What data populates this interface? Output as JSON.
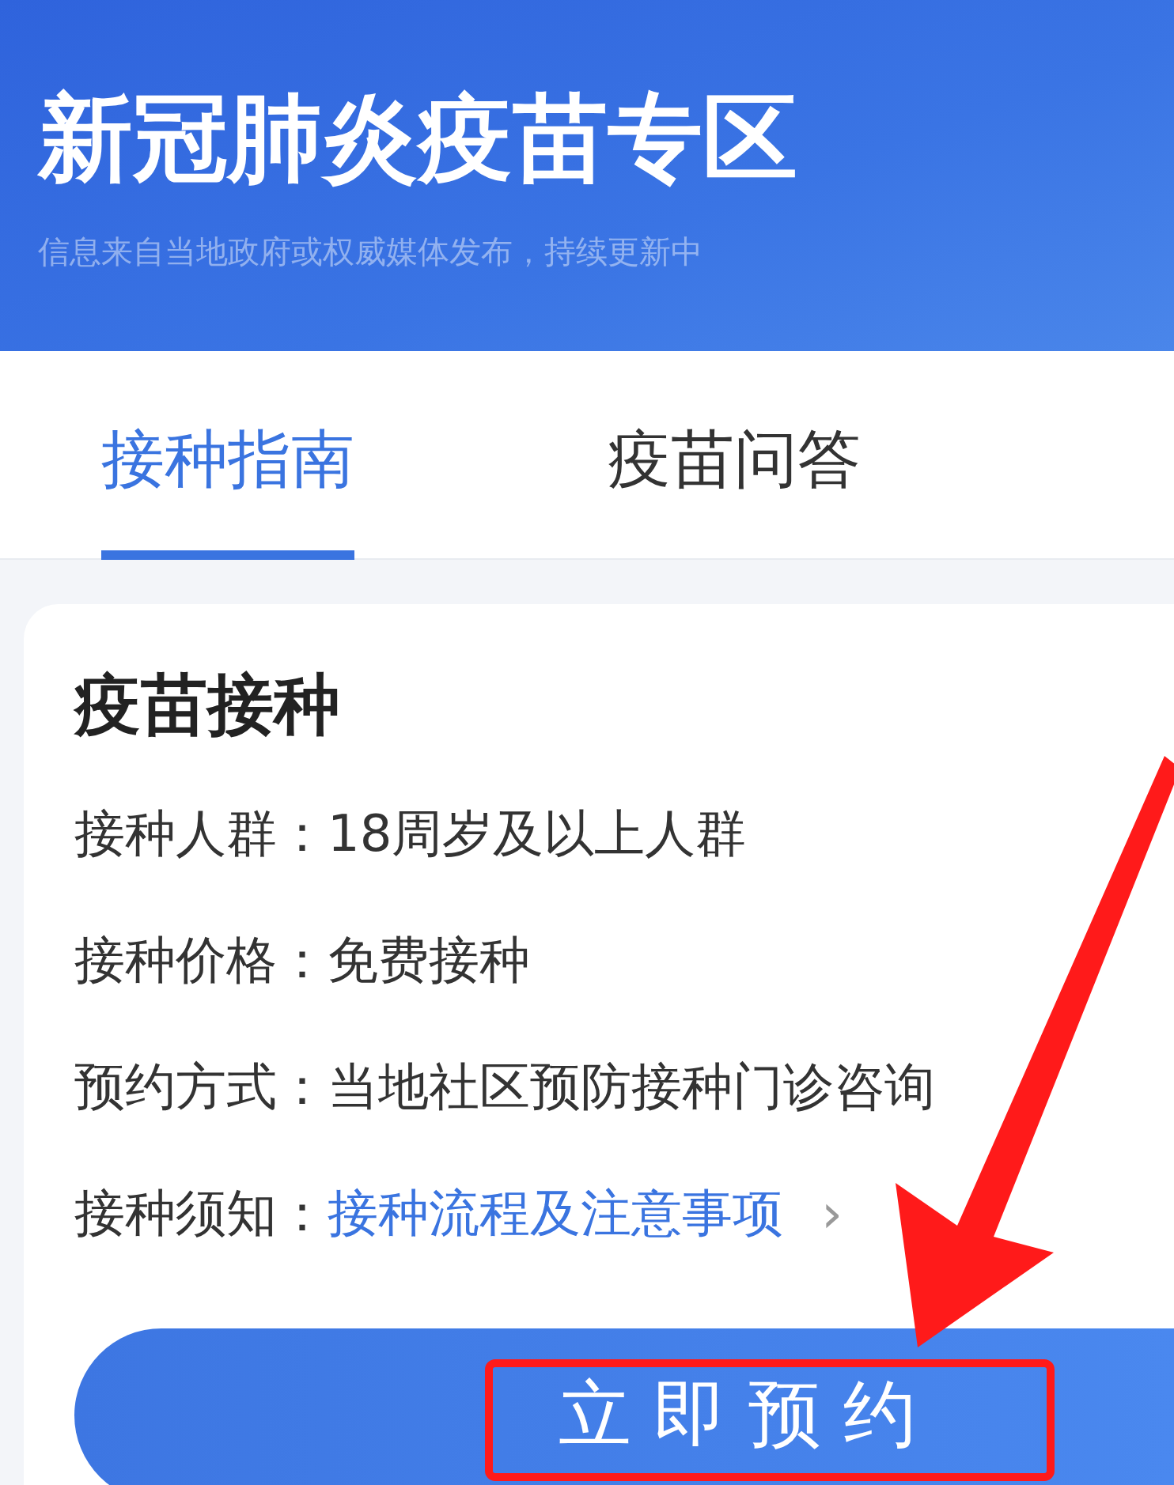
{
  "header": {
    "title": "新冠肺炎疫苗专区",
    "subtitle": "信息来自当地政府或权威媒体发布，持续更新中"
  },
  "tabs": [
    {
      "label": "接种指南",
      "selected": true
    },
    {
      "label": "疫苗问答",
      "selected": false
    }
  ],
  "card": {
    "title": "疫苗接种",
    "rows": [
      {
        "kind": "text",
        "label": "接种人群：",
        "value": "18周岁及以上人群"
      },
      {
        "kind": "text",
        "label": "接种价格：",
        "value": "免费接种"
      },
      {
        "kind": "text",
        "label": "预约方式：",
        "value": "当地社区预防接种门诊咨询"
      },
      {
        "kind": "link",
        "label": "接种须知：",
        "value": "接种流程及注意事项",
        "chevron": "›"
      }
    ],
    "button": "立即预约"
  }
}
